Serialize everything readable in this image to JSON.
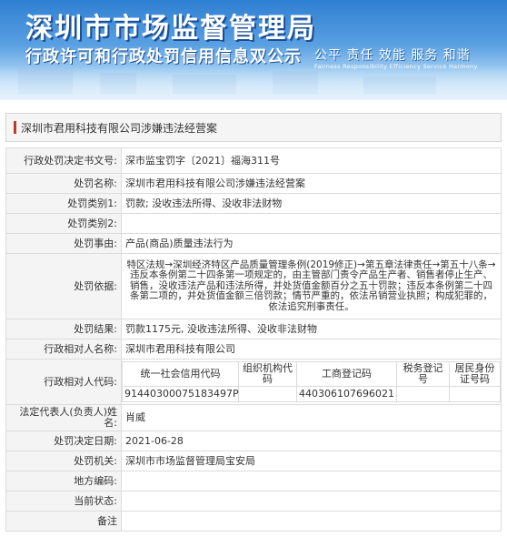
{
  "banner": {
    "title": "深圳市市场监督管理局",
    "subtitle": "行政许可和行政处罚信用信息双公示",
    "motto": "公平  责任  效能  服务  和谐",
    "motto_en": "Fairness  Responsibility  Efficiency  Service  Harmony"
  },
  "section": {
    "title": "深圳市君用科技有限公司涉嫌违法经营案"
  },
  "rows": {
    "decision_no": {
      "label": "行政处罚决定书文号:",
      "value": "深市监宝罚字〔2021〕福海311号"
    },
    "case_name": {
      "label": "处罚名称:",
      "value": "深圳市君用科技有限公司涉嫌违法经营案"
    },
    "category1": {
      "label": "处罚类别1:",
      "value": "罚款; 没收违法所得、没收非法财物"
    },
    "category2": {
      "label": "处罚类别2:",
      "value": ""
    },
    "reason": {
      "label": "处罚事由:",
      "value": "产品(商品)质量违法行为"
    },
    "basis": {
      "label": "处罚依据:",
      "value": "特区法规→深圳经济特区产品质量管理条例(2019修正)→第五章法律责任→第五十八条→违反本条例第二十四条第一项规定的，由主管部门责令产品生产者、销售者停止生产、销售，没收违法产品和违法所得，并处货值金额百分之五十罚款；违反本条例第二十四条第二项的，并处货值金额三倍罚款；情节严重的，依法吊销营业执照；构成犯罪的，依法追究刑事责任。"
    },
    "result": {
      "label": "处罚结果:",
      "value": "罚款1175元, 没收违法所得、没收非法财物"
    },
    "counterpart_name": {
      "label": "行政相对人名称:",
      "value": "深圳市君用科技有限公司"
    },
    "counterpart_code": {
      "label": "行政相对人代码:",
      "headers": [
        "统一社会信用代码",
        "组织机构代码",
        "工商登记码",
        "税务登记号",
        "居民身份证号码"
      ],
      "values": [
        "91440300075183497P",
        "",
        "440306107696021",
        "",
        ""
      ]
    },
    "legal_rep": {
      "label": "法定代表人(负责人)姓名:",
      "value": "肖威"
    },
    "decision_date": {
      "label": "处罚决定日期:",
      "value": "2021-06-28"
    },
    "authority": {
      "label": "处罚机关:",
      "value": "深圳市市场监督管理局宝安局"
    },
    "local_code": {
      "label": "地方编码:",
      "value": ""
    },
    "status": {
      "label": "当前状态:",
      "value": ""
    },
    "remark": {
      "label": "备注",
      "value": ""
    }
  }
}
